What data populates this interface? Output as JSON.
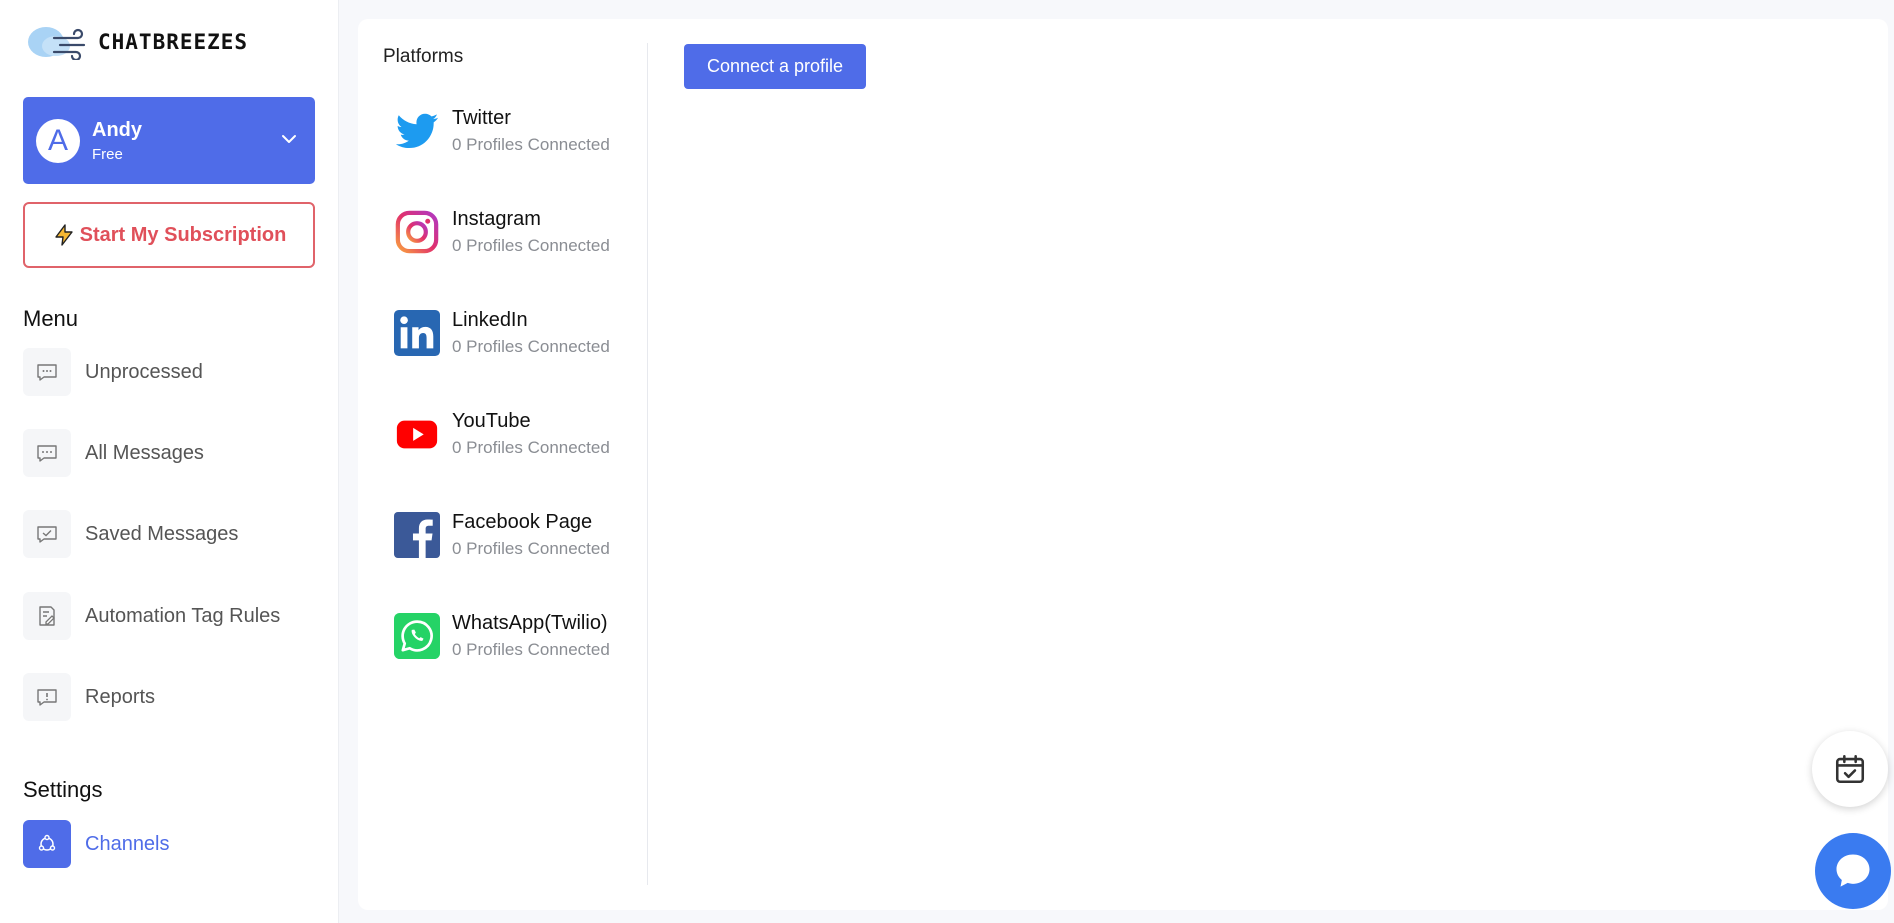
{
  "brand": {
    "name": "CHATBREEZES"
  },
  "user": {
    "initial": "A",
    "name": "Andy",
    "plan": "Free"
  },
  "subscription_button": {
    "label": "Start My Subscription"
  },
  "menu": {
    "title": "Menu",
    "items": [
      {
        "label": "Unprocessed",
        "icon": "chat-bubble-icon"
      },
      {
        "label": "All Messages",
        "icon": "chat-dots-icon"
      },
      {
        "label": "Saved Messages",
        "icon": "chat-check-icon"
      },
      {
        "label": "Automation Tag Rules",
        "icon": "document-edit-icon"
      },
      {
        "label": "Reports",
        "icon": "report-alert-icon"
      }
    ]
  },
  "settings": {
    "title": "Settings",
    "items": [
      {
        "label": "Channels",
        "icon": "channels-icon",
        "active": true
      }
    ]
  },
  "platforms": {
    "title": "Platforms",
    "items": [
      {
        "name": "Twitter",
        "status": "0 Profiles Connected",
        "icon": "twitter-icon",
        "color": "#1d9bf0"
      },
      {
        "name": "Instagram",
        "status": "0 Profiles Connected",
        "icon": "instagram-icon",
        "color": "#e1306c"
      },
      {
        "name": "LinkedIn",
        "status": "0 Profiles Connected",
        "icon": "linkedin-icon",
        "color": "#2867b2"
      },
      {
        "name": "YouTube",
        "status": "0 Profiles Connected",
        "icon": "youtube-icon",
        "color": "#ff0000"
      },
      {
        "name": "Facebook Page",
        "status": "0 Profiles Connected",
        "icon": "facebook-icon",
        "color": "#3b5998"
      },
      {
        "name": "WhatsApp(Twilio)",
        "status": "0 Profiles Connected",
        "icon": "whatsapp-icon",
        "color": "#25d366"
      }
    ]
  },
  "connect_button": {
    "label": "Connect a profile"
  },
  "colors": {
    "accent": "#4f6ce8",
    "danger": "#e0505a"
  }
}
